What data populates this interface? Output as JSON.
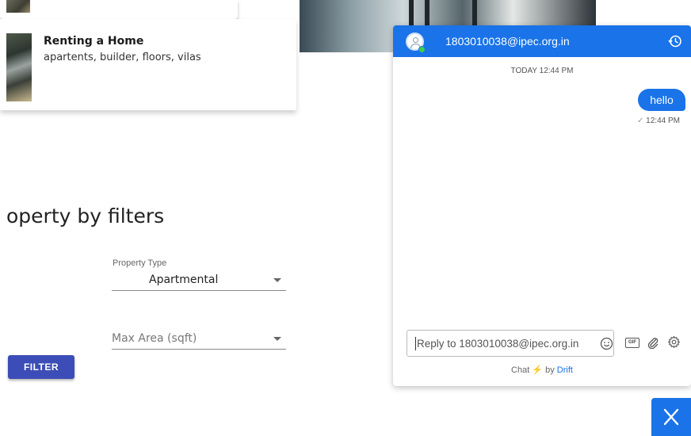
{
  "listing": {
    "renting_title": "Renting a Home",
    "renting_subtitle": "apartents, builder, floors, vilas"
  },
  "filters": {
    "heading": "operty by filters",
    "property_type_label": "Property Type",
    "property_type_value": "Apartmental",
    "max_area_placeholder": "Max Area (sqft)",
    "filter_button": "FILTER"
  },
  "chat": {
    "contact_email": "1803010038@ipec.org.in",
    "date_divider": "TODAY 12:44 PM",
    "message_text": "hello",
    "message_time": "12:44 PM",
    "reply_placeholder": "Reply to 1803010038@ipec.org.in",
    "gif_label": "GIF",
    "footer_prefix": "Chat",
    "footer_by": "by",
    "footer_brand": "Drift"
  },
  "colors": {
    "primary_blue": "#1a73e8",
    "filter_button_bg": "#3d4db7",
    "online_status": "#3ccf4e",
    "bolt": "#f5b400"
  },
  "icons": [
    "history-icon",
    "emoji-icon",
    "gif-icon",
    "paperclip-icon",
    "gear-icon",
    "close-icon",
    "check-icon",
    "bolt-icon"
  ]
}
